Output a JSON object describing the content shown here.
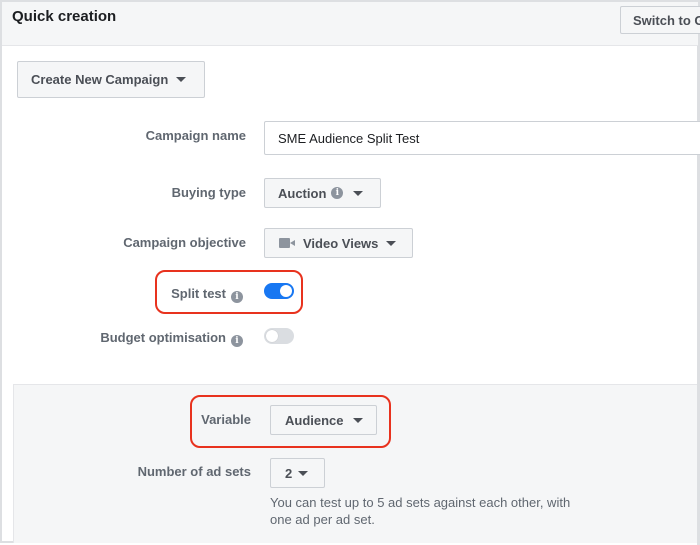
{
  "header": {
    "title": "Quick creation",
    "switch_button": "Switch to Guided Creation"
  },
  "campaign_mode": {
    "label": "Create New Campaign"
  },
  "form": {
    "campaign_name": {
      "label": "Campaign name",
      "value": "SME Audience Split Test"
    },
    "buying_type": {
      "label": "Buying type",
      "value": "Auction"
    },
    "campaign_objective": {
      "label": "Campaign objective",
      "value": "Video Views",
      "icon": "video-camera-icon"
    },
    "split_test": {
      "label": "Split test",
      "enabled": true
    },
    "budget_optimisation": {
      "label": "Budget optimisation",
      "enabled": false
    }
  },
  "split_test_panel": {
    "variable": {
      "label": "Variable",
      "value": "Audience"
    },
    "number_of_ad_sets": {
      "label": "Number of ad sets",
      "value": "2"
    },
    "help_text": "You can test up to 5 ad sets against each other, with one ad per ad set."
  },
  "icons": {
    "info": "i"
  },
  "colors": {
    "highlight": "#e8321e",
    "toggle_on": "#1877f2",
    "toggle_off": "#dadde1"
  }
}
